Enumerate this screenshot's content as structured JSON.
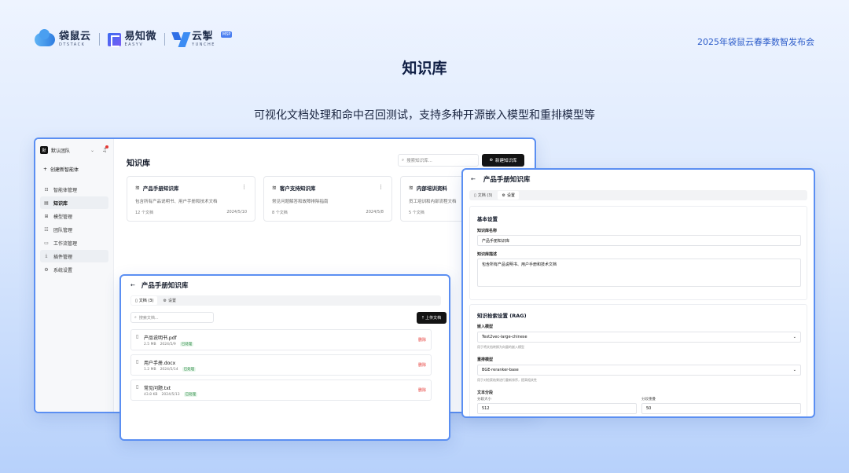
{
  "header": {
    "brand1": {
      "cn": "袋鼠云",
      "en": "DTSTACK"
    },
    "brand2": {
      "cn": "易知微",
      "en": "EASYV"
    },
    "brand3": {
      "cn": "云掣",
      "en": "YUNCHE",
      "badge": "MSP"
    },
    "event": "2025年袋鼠云春季数智发布会"
  },
  "title": "知识库",
  "subtitle": "可视化文档处理和命中召回测试，支持多种开源嵌入模型和重排模型等",
  "window1": {
    "team": {
      "icon_text": "默",
      "name": "默认团队"
    },
    "create_label": "创建新智能体",
    "nav": [
      {
        "icon": "robot-icon",
        "glyph": "⊡",
        "label": "智能体管理"
      },
      {
        "icon": "book-icon",
        "glyph": "▤",
        "label": "知识库"
      },
      {
        "icon": "model-icon",
        "glyph": "⊞",
        "label": "模型管理"
      },
      {
        "icon": "team-icon",
        "glyph": "☷",
        "label": "团队管理"
      },
      {
        "icon": "workflow-icon",
        "glyph": "▭",
        "label": "工作流管理"
      },
      {
        "icon": "plugin-icon",
        "glyph": "⤓",
        "label": "插件管理"
      },
      {
        "icon": "settings-icon",
        "glyph": "⚙",
        "label": "系统设置"
      }
    ],
    "page_title": "知识库",
    "search_placeholder": "搜索知识库...",
    "new_button": "新建知识库",
    "cards": [
      {
        "title": "产品手册知识库",
        "desc": "包含所有产品说明书、用户手册和技术文档",
        "count": "12 个文档",
        "date": "2024/5/10"
      },
      {
        "title": "客户支持知识库",
        "desc": "常见问题解答和故障排除指南",
        "count": "8 个文档",
        "date": "2024/5/8"
      },
      {
        "title": "内部培训资料",
        "desc": "员工培训和内部流程文档",
        "count": "5 个文档",
        "date": ""
      }
    ]
  },
  "window2": {
    "title": "产品手册知识库",
    "tabs": [
      "文档 (3)",
      "设置"
    ],
    "search_placeholder": "搜索文档...",
    "upload_button": "上传文档",
    "files": [
      {
        "name": "产品说明书.pdf",
        "size": "2.5 MB",
        "date": "2024/5/9",
        "status": "已处理",
        "delete": "删除"
      },
      {
        "name": "用户手册.docx",
        "size": "1.2 MB",
        "date": "2024/5/14",
        "status": "已处理",
        "delete": "删除"
      },
      {
        "name": "常见问题.txt",
        "size": "43.8 KB",
        "date": "2024/5/13",
        "status": "已处理",
        "delete": "删除"
      }
    ]
  },
  "window3": {
    "title": "产品手册知识库",
    "tabs": [
      "文档 (3)",
      "设置"
    ],
    "basic": {
      "section": "基本设置",
      "name_label": "知识库名称",
      "name_value": "产品手册知识库",
      "desc_label": "知识库描述",
      "desc_value": "包含所有产品说明书、用户手册和技术文档"
    },
    "rag": {
      "section": "知识检索设置 (RAG)",
      "embed_label": "嵌入模型",
      "embed_value": "Text2vec-large-chinese",
      "embed_hint": "用于将文档转换为向量的嵌入模型",
      "rerank_label": "重排模型",
      "rerank_value": "BGE-reranker-base",
      "rerank_hint": "用于对检索结果进行重新排序，提高相关性",
      "chunk_label": "文本分段",
      "chunk_size_label": "分段大小",
      "chunk_size_value": "512",
      "overlap_label": "分段重叠",
      "overlap_value": "50"
    }
  }
}
